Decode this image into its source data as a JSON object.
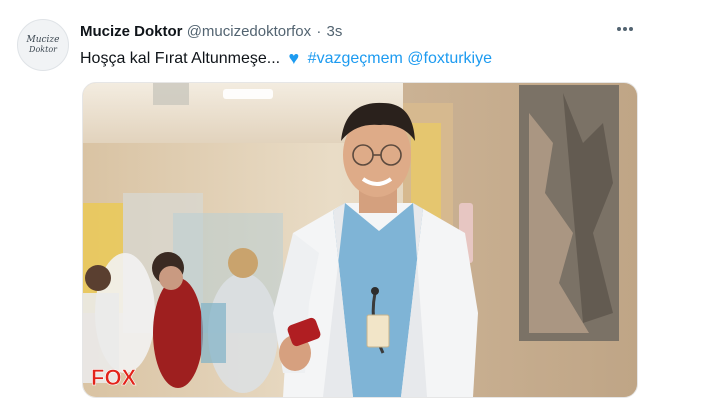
{
  "account": {
    "display_name": "Mucize Doktor",
    "handle": "@mucizedoktorfox",
    "separator": "·",
    "time": "3s",
    "avatar_line1": "Mucize",
    "avatar_line2": "Doktor"
  },
  "tweet": {
    "text": "Hoşça kal Fırat Altunmeşe...",
    "emoji_icon": "blue-heart-icon",
    "hashtag": "#vazgeçmem",
    "mention": "@foxturkiye"
  },
  "menu_icon": "more-horizontal-icon",
  "media": {
    "watermark": "FOX",
    "watermark_color": "#e2231a"
  },
  "colors": {
    "link": "#1d9bf0",
    "secondary_text": "#536471",
    "primary_text": "#0f1419"
  }
}
